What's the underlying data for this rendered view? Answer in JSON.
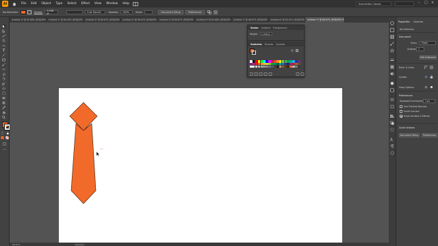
{
  "app": {
    "logo": "Ai"
  },
  "menu": [
    "File",
    "Edit",
    "Object",
    "Type",
    "Select",
    "Effect",
    "View",
    "Window",
    "Help"
  ],
  "workspace": "Essentials Classic",
  "control_bar": {
    "selection_label": "No Selection",
    "stroke_label": "Stroke:",
    "stroke_value": "1.038 pt",
    "brush_value": "3 pt. Round",
    "opacity_label": "Opacity:",
    "opacity_value": "100%",
    "style_label": "Style:",
    "document_setup": "Document Setup",
    "preferences": "Preferences"
  },
  "tabs": [
    "Untitled-1* @ 82.68% (RGB/GPU Preview)",
    "Untitled-2* @ 80.55% (RGB/GPU Preview)",
    "Untitled-3* @ 66.67% (RGB/GPU Preview)",
    "Untitled-5* @ 66.67% (RGB/GPU Preview)",
    "Untitled-4* @ 66.67% (RGB/GPU Preview)",
    "Untitled-6* @ 80.68% (RGB/GPU Preview)",
    "Untitled-7* @ 66.67% (RGB/GPU Preview)",
    "Untitled-8* @ 63.01% (RGB/GPU Preview)",
    "Untitled-7* @ 66.67% (RGB/GPU Preview)"
  ],
  "stroke_panel": {
    "tabs": [
      "Stroke",
      "Gradient",
      "Transparency"
    ],
    "weight_label": "Weight:",
    "weight_value": "1.038 pt"
  },
  "swatches_panel": {
    "tabs": [
      "Swatches",
      "Brushes",
      "Symbols"
    ],
    "colors": [
      "#ffffff",
      "#000000",
      "#ff0000",
      "#ffff00",
      "#00ff00",
      "#00ffff",
      "#0000ff",
      "#ff00ff",
      "#cc2229",
      "#ef4136",
      "#f7941d",
      "#fff200",
      "#8dc63f",
      "#39b54a",
      "#00a651",
      "#00a99d",
      "#27aae1",
      "#2e3192",
      "#662d91",
      "#92278f",
      "#ec008c",
      "#ed1c24",
      "#f26522",
      "#f7941d",
      "#fbb040",
      "#d7df23",
      "#8dc63f",
      "#00a651",
      "#009444",
      "#006838",
      "#00a79d",
      "#1c75bc",
      "#2b3990",
      "#262262",
      "#92278f",
      "#be1e2d",
      "#a3623a",
      "#754c29",
      "#ffffff",
      "#e6e7e8",
      "#d1d3d4",
      "#bcbec0",
      "#a7a9ac",
      "#939598",
      "#808285",
      "#6d6e71",
      "#58595b",
      "#414042",
      "#231f20",
      "#c49a6c",
      "#8b5e3c",
      "#603913",
      "#3c2415",
      "#f26a2a",
      "#b4b4b4",
      "#7a7a7a",
      "#3a3a3a"
    ]
  },
  "right_panel": {
    "tabs": [
      "Properties",
      "Libraries"
    ],
    "selection": "No Selection",
    "document_heading": "Document",
    "units_label": "Units:",
    "units_value": "Pixels",
    "artboard_label": "Artboard:",
    "artboard_value": "1",
    "edit_artboards": "Edit Artboards",
    "ruler_grids": "Ruler & Grids",
    "guides": "Guides",
    "snap_options": "Snap Options",
    "preferences_heading": "Preferences",
    "keyboard_increment_label": "Keyboard Increment:",
    "keyboard_increment_value": "1 px",
    "checkboxes": [
      {
        "label": "Use Preview Bounds",
        "checked": false
      },
      {
        "label": "Scale Corners",
        "checked": false
      },
      {
        "label": "Scale Strokes & Effects",
        "checked": true
      }
    ],
    "quick_actions_heading": "Quick Actions",
    "document_setup_btn": "Document Setup",
    "preferences_btn": "Preferences"
  },
  "statusbar": {
    "zoom": "66.67%",
    "tool": "Selection"
  },
  "colors": {
    "tie_fill": "#f26a2a",
    "fill_swatch": "#f26a2a",
    "accent": "#ff9a00"
  }
}
